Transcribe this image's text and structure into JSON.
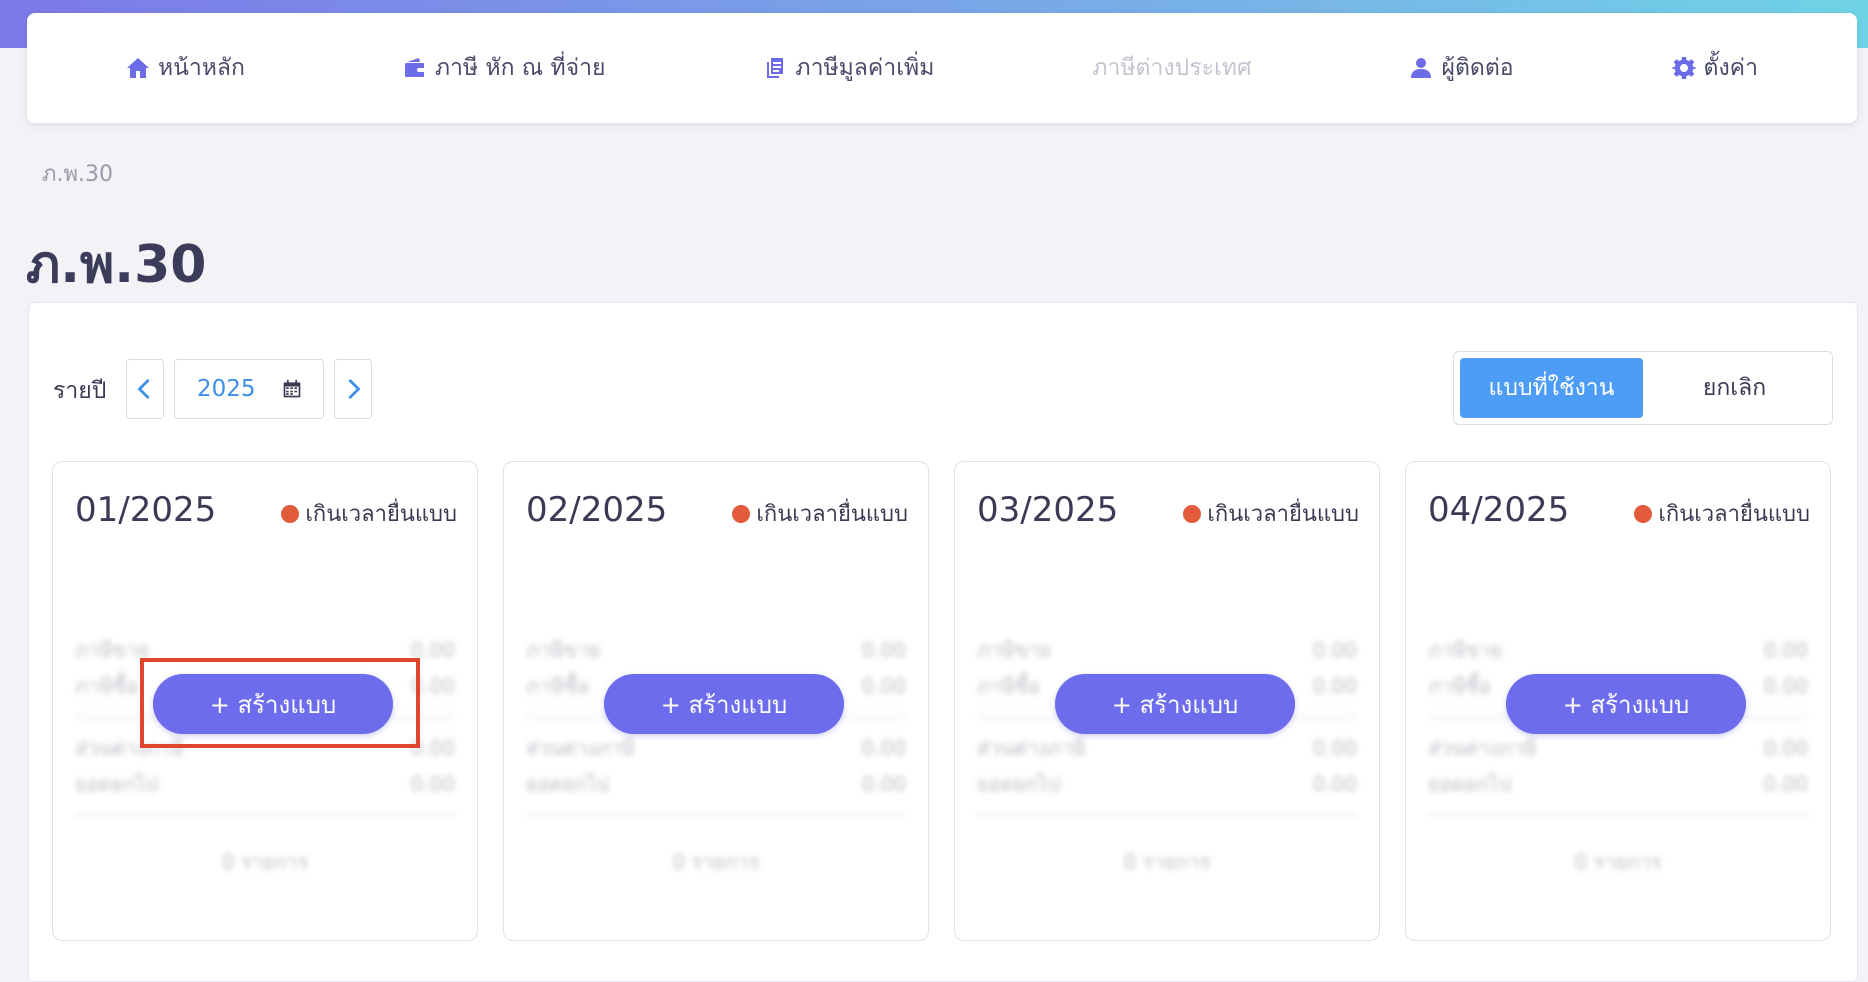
{
  "nav": {
    "items": [
      {
        "label": "หน้าหลัก",
        "icon": "home-icon",
        "disabled": false
      },
      {
        "label": "ภาษี หัก ณ ที่จ่าย",
        "icon": "wallet-icon",
        "disabled": false
      },
      {
        "label": "ภาษีมูลค่าเพิ่ม",
        "icon": "document-icon",
        "disabled": false
      },
      {
        "label": "ภาษีต่างประเทศ",
        "icon": "",
        "disabled": true
      },
      {
        "label": "ผู้ติดต่อ",
        "icon": "user-icon",
        "disabled": false
      },
      {
        "label": "ตั้งค่า",
        "icon": "gear-icon",
        "disabled": false
      }
    ]
  },
  "breadcrumb": "ภ.พ.30",
  "page_title": "ภ.พ.30",
  "filter": {
    "year_label": "รายปี",
    "year_value": "2025"
  },
  "segmented": {
    "active_label": "แบบที่ใช้งาน",
    "cancel_label": "ยกเลิก"
  },
  "cards": [
    {
      "period": "01/2025",
      "status": "เกินเวลายื่นแบบ",
      "button": "+ สร้างแบบ",
      "rows": [
        "ภาษีขาย",
        "ภาษีซื้อ",
        "ส่วนต่างภาษี",
        "ยอดยกไป"
      ],
      "values": [
        "0.00",
        "0.00",
        "0.00",
        "0.00"
      ],
      "count": "0 รายการ"
    },
    {
      "period": "02/2025",
      "status": "เกินเวลายื่นแบบ",
      "button": "+ สร้างแบบ",
      "rows": [
        "ภาษีขาย",
        "ภาษีซื้อ",
        "ส่วนต่างภาษี",
        "ยอดยกไป"
      ],
      "values": [
        "0.00",
        "0.00",
        "0.00",
        "0.00"
      ],
      "count": "0 รายการ"
    },
    {
      "period": "03/2025",
      "status": "เกินเวลายื่นแบบ",
      "button": "+ สร้างแบบ",
      "rows": [
        "ภาษีขาย",
        "ภาษีซื้อ",
        "ส่วนต่างภาษี",
        "ยอดยกไป"
      ],
      "values": [
        "0.00",
        "0.00",
        "0.00",
        "0.00"
      ],
      "count": "0 รายการ"
    },
    {
      "period": "04/2025",
      "status": "เกินเวลายื่นแบบ",
      "button": "+ สร้างแบบ",
      "rows": [
        "ภาษีขาย",
        "ภาษีซื้อ",
        "ส่วนต่างภาษี",
        "ยอดยกไป"
      ],
      "values": [
        "0.00",
        "0.00",
        "0.00",
        "0.00"
      ],
      "count": "0 รายการ"
    }
  ],
  "colors": {
    "accent": "#6c6ced",
    "active_segment": "#4d9cf5",
    "status_overdue": "#e25b3a",
    "highlight": "#e0462c"
  }
}
